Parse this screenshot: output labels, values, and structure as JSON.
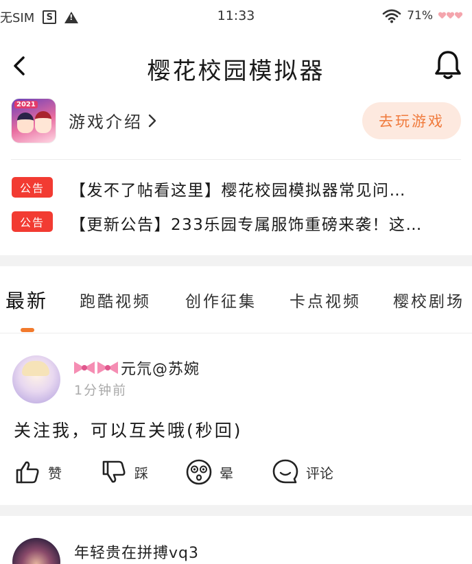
{
  "status_bar": {
    "sim": "无SIM",
    "sim_icon_text": "S",
    "time": "11:33",
    "battery": "71%",
    "icons": [
      "sim-card-icon",
      "warning-icon",
      "wifi-icon",
      "battery-hearts-icon"
    ]
  },
  "header": {
    "title": "樱花校园模拟器",
    "back_icon": "chevron-left-icon",
    "notification_icon": "bell-icon"
  },
  "game": {
    "icon_year": "2021",
    "intro_label": "游戏介绍",
    "play_button": "去玩游戏",
    "accent": "#f07a3c"
  },
  "announcements": [
    {
      "badge": "公告",
      "text": "【发不了帖看这里】樱花校园模拟器常见问…"
    },
    {
      "badge": "公告",
      "text": "【更新公告】233乐园专属服饰重磅来袭！这…"
    }
  ],
  "tabs": [
    {
      "label": "最新",
      "active": true
    },
    {
      "label": "跑酷视频",
      "active": false
    },
    {
      "label": "创作征集",
      "active": false
    },
    {
      "label": "卡点视频",
      "active": false
    },
    {
      "label": "樱校剧场",
      "active": false
    }
  ],
  "posts": [
    {
      "user_name": "元氘@苏婉",
      "time": "1分钟前",
      "content": "关注我，可以互关哦(秒回)",
      "actions": {
        "like": "赞",
        "dislike": "踩",
        "dizzy": "晕",
        "comment": "评论"
      }
    },
    {
      "user_name": "年轻贵在拼搏vq3"
    }
  ],
  "colors": {
    "badge_red": "#f23b32",
    "tab_indicator": "#f27a2c",
    "band_gray": "#f2f2f2"
  }
}
